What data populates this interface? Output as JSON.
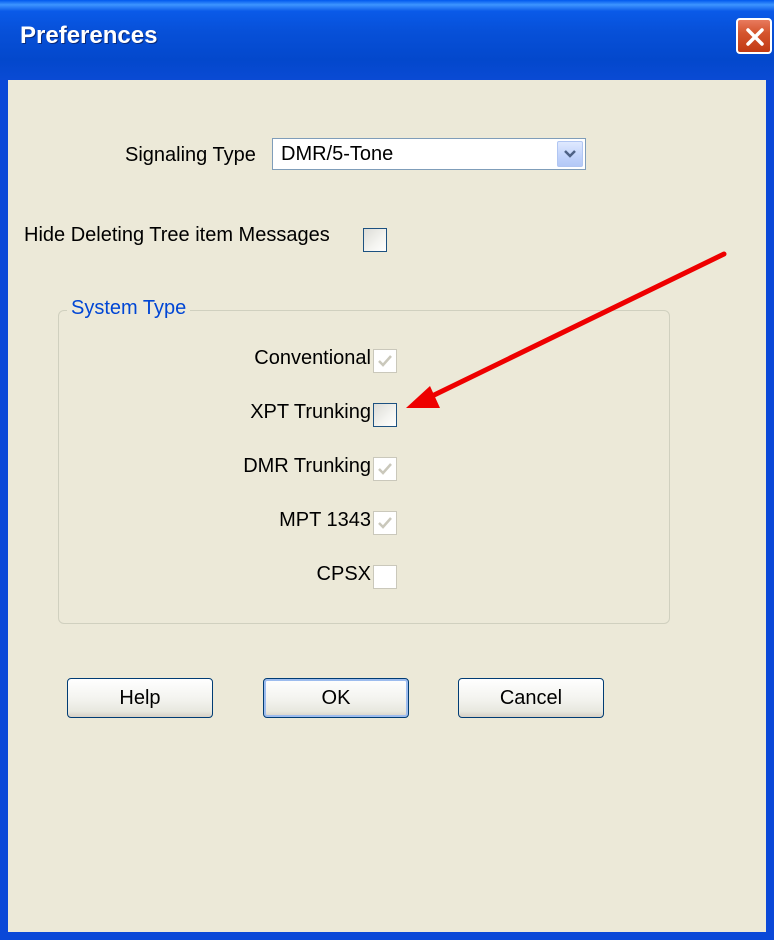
{
  "window": {
    "title": "Preferences"
  },
  "signaling": {
    "label": "Signaling Type",
    "value": "DMR/5-Tone"
  },
  "hide_messages": {
    "label": "Hide Deleting Tree item Messages",
    "checked": false
  },
  "system_type": {
    "title": "System Type",
    "items": [
      {
        "label": "Conventional",
        "checked": true,
        "enabled": false
      },
      {
        "label": "XPT Trunking",
        "checked": false,
        "enabled": true
      },
      {
        "label": "DMR Trunking",
        "checked": true,
        "enabled": false
      },
      {
        "label": "MPT 1343",
        "checked": true,
        "enabled": false
      },
      {
        "label": "CPSX",
        "checked": false,
        "enabled": false
      }
    ]
  },
  "buttons": {
    "help": "Help",
    "ok": "OK",
    "cancel": "Cancel"
  },
  "annotation": {
    "arrow_color": "#ee0000"
  },
  "colors": {
    "titlebar": "#0a5ae8",
    "dialog_bg": "#ece9d8",
    "group_title": "#0046d5"
  }
}
